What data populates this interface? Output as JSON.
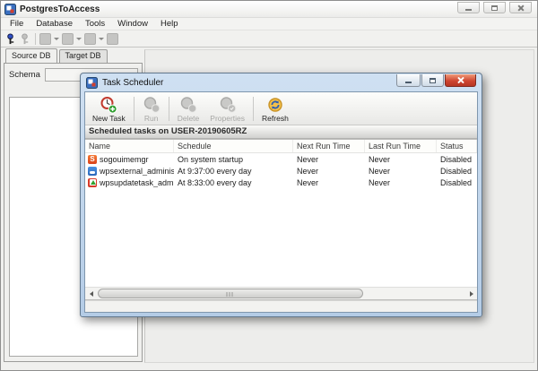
{
  "main_window": {
    "title": "PostgresToAccess",
    "menu_items": [
      "File",
      "Database",
      "Tools",
      "Window",
      "Help"
    ],
    "tabs": [
      {
        "label": "Source DB"
      },
      {
        "label": "Target DB"
      }
    ],
    "schema": {
      "label": "Schema",
      "value": ""
    }
  },
  "dialog": {
    "title": "Task Scheduler",
    "toolbar": {
      "new_task": "New Task",
      "run": "Run",
      "delete": "Delete",
      "properties": "Properties",
      "refresh": "Refresh"
    },
    "header_text": "Scheduled tasks on USER-20190605RZ",
    "table": {
      "columns": [
        "Name",
        "Schedule",
        "Next Run Time",
        "Last Run Time",
        "Status"
      ],
      "rows": [
        {
          "name": "sogouimemgr",
          "schedule": "On system startup",
          "next_run": "Never",
          "last_run": "Never",
          "status": "Disabled"
        },
        {
          "name": "wpsexternal_administr...",
          "schedule": "At 9:37:00 every day",
          "next_run": "Never",
          "last_run": "Never",
          "status": "Disabled"
        },
        {
          "name": "wpsupdatetask_admini...",
          "schedule": "At 8:33:00 every day",
          "next_run": "Never",
          "last_run": "Never",
          "status": "Disabled"
        }
      ]
    },
    "icons": {
      "sogou_letter": "S"
    }
  },
  "colors": {
    "dialog_frame": "#b9cfe8",
    "close_button_red": "#cf4632",
    "new_task_clock_red": "#c23a2e",
    "plus_badge_green": "#2f9e2f",
    "refresh_yellow": "#f3c14b",
    "refresh_arrow_blue": "#2f5fb0",
    "sogou_orange": "#e8521c",
    "wps_blue": "#2f7bd4",
    "update_green": "#2fa32f"
  }
}
